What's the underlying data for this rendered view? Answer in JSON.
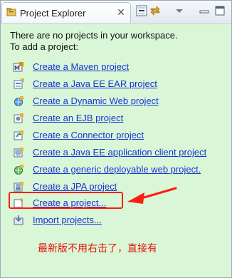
{
  "view": {
    "tab_label": "Project Explorer",
    "tab_close": "✕"
  },
  "toolbar": {
    "buttons": [
      "collapse-all-icon",
      "link-with-editor-icon",
      "view-menu-icon",
      "minimize-icon",
      "maximize-icon"
    ]
  },
  "content": {
    "background_color": "#d9f7d6",
    "intro_line1": "There are no projects in your workspace.",
    "intro_line2": "To add a project:",
    "links": [
      {
        "label": "Create a Maven project",
        "icon": "maven-project-icon"
      },
      {
        "label": "Create a Java EE EAR project",
        "icon": "ear-project-icon"
      },
      {
        "label": "Create a Dynamic Web project",
        "icon": "web-project-icon"
      },
      {
        "label": "Create an EJB project",
        "icon": "ejb-project-icon"
      },
      {
        "label": "Create a Connector project",
        "icon": "connector-project-icon"
      },
      {
        "label": "Create a Java EE application client project",
        "icon": "app-client-project-icon"
      },
      {
        "label": "Create a generic deployable web project.",
        "icon": "generic-web-project-icon"
      },
      {
        "label": "Create a JPA project",
        "icon": "jpa-project-icon"
      },
      {
        "label": "Create a project...",
        "icon": "new-project-icon"
      },
      {
        "label": "Import projects...",
        "icon": "import-icon"
      }
    ],
    "annotation_note": "最新版不用右击了，直接有",
    "annotation_color": "#ff1c14"
  }
}
